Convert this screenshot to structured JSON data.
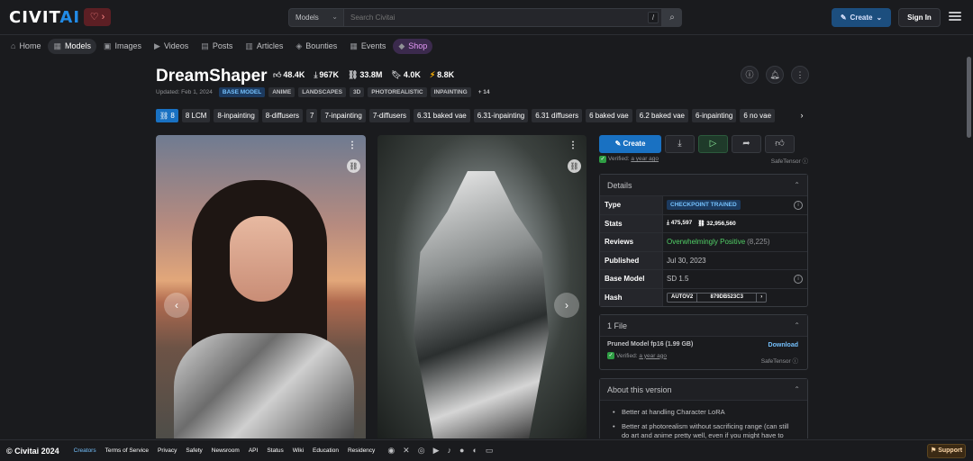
{
  "header": {
    "logo_main": "CIVIT",
    "logo_accent": "AI",
    "heart": "♡ ›",
    "search_scope": "Models",
    "search_placeholder": "Search Civitai",
    "slash_key": "/",
    "create_label": "Create",
    "signin_label": "Sign In"
  },
  "nav": {
    "items": [
      {
        "icon": "⌂",
        "label": "Home"
      },
      {
        "icon": "▦",
        "label": "Models"
      },
      {
        "icon": "▣",
        "label": "Images"
      },
      {
        "icon": "▶",
        "label": "Videos"
      },
      {
        "icon": "▤",
        "label": "Posts"
      },
      {
        "icon": "▥",
        "label": "Articles"
      },
      {
        "icon": "◈",
        "label": "Bounties"
      },
      {
        "icon": "▦",
        "label": "Events"
      },
      {
        "icon": "◆",
        "label": "Shop"
      }
    ]
  },
  "model": {
    "title": "DreamShaper",
    "stats": {
      "likes": "48.4K",
      "downloads": "967K",
      "generations": "33.8M",
      "bookmarks": "4.0K",
      "buzz": "8.8K"
    },
    "updated": "Updated: Feb 1, 2024",
    "base_tag": "BASE MODEL",
    "tags": [
      "ANIME",
      "LANDSCAPES",
      "3D",
      "PHOTOREALISTIC",
      "INPAINTING"
    ],
    "more_tags": "+ 14"
  },
  "versions": [
    "8",
    "8 LCM",
    "8-inpainting",
    "8-diffusers",
    "7",
    "7-inpainting",
    "7-diffusers",
    "6.31 baked vae",
    "6.31-inpainting",
    "6.31 diffusers",
    "6 baked vae",
    "6.2 baked vae",
    "6-inpainting",
    "6 no vae"
  ],
  "actions": {
    "create": "Create"
  },
  "verified": {
    "label": "Verified:",
    "when": "a year ago",
    "format": "SafeTensor"
  },
  "details": {
    "heading": "Details",
    "type_key": "Type",
    "type_val": "CHECKPOINT TRAINED",
    "stats_key": "Stats",
    "stats_downloads": "475,597",
    "stats_generations": "32,956,560",
    "reviews_key": "Reviews",
    "reviews_val": "Overwhelmingly Positive",
    "reviews_count": "(8,225)",
    "published_key": "Published",
    "published_val": "Jul 30, 2023",
    "base_key": "Base Model",
    "base_val": "SD 1.5",
    "hash_key": "Hash",
    "hash_type": "AUTOV2",
    "hash_val": "879DB523C3"
  },
  "files": {
    "heading": "1 File",
    "name": "Pruned Model fp16 (1.99 GB)",
    "download": "Download",
    "verified": "Verified:",
    "when": "a year ago",
    "format": "SafeTensor"
  },
  "about": {
    "heading": "About this version",
    "bullets": [
      "Better at handling Character LoRA",
      "Better at photorealism without sacrificing range (can still do art and anime pretty well, even if you might have to"
    ]
  },
  "footer": {
    "copyright": "© Civitai 2024",
    "links": [
      "Creators",
      "Terms of Service",
      "Privacy",
      "Safety",
      "Newsroom",
      "API",
      "Status",
      "Wiki",
      "Education",
      "Residency"
    ],
    "support": "Support"
  }
}
